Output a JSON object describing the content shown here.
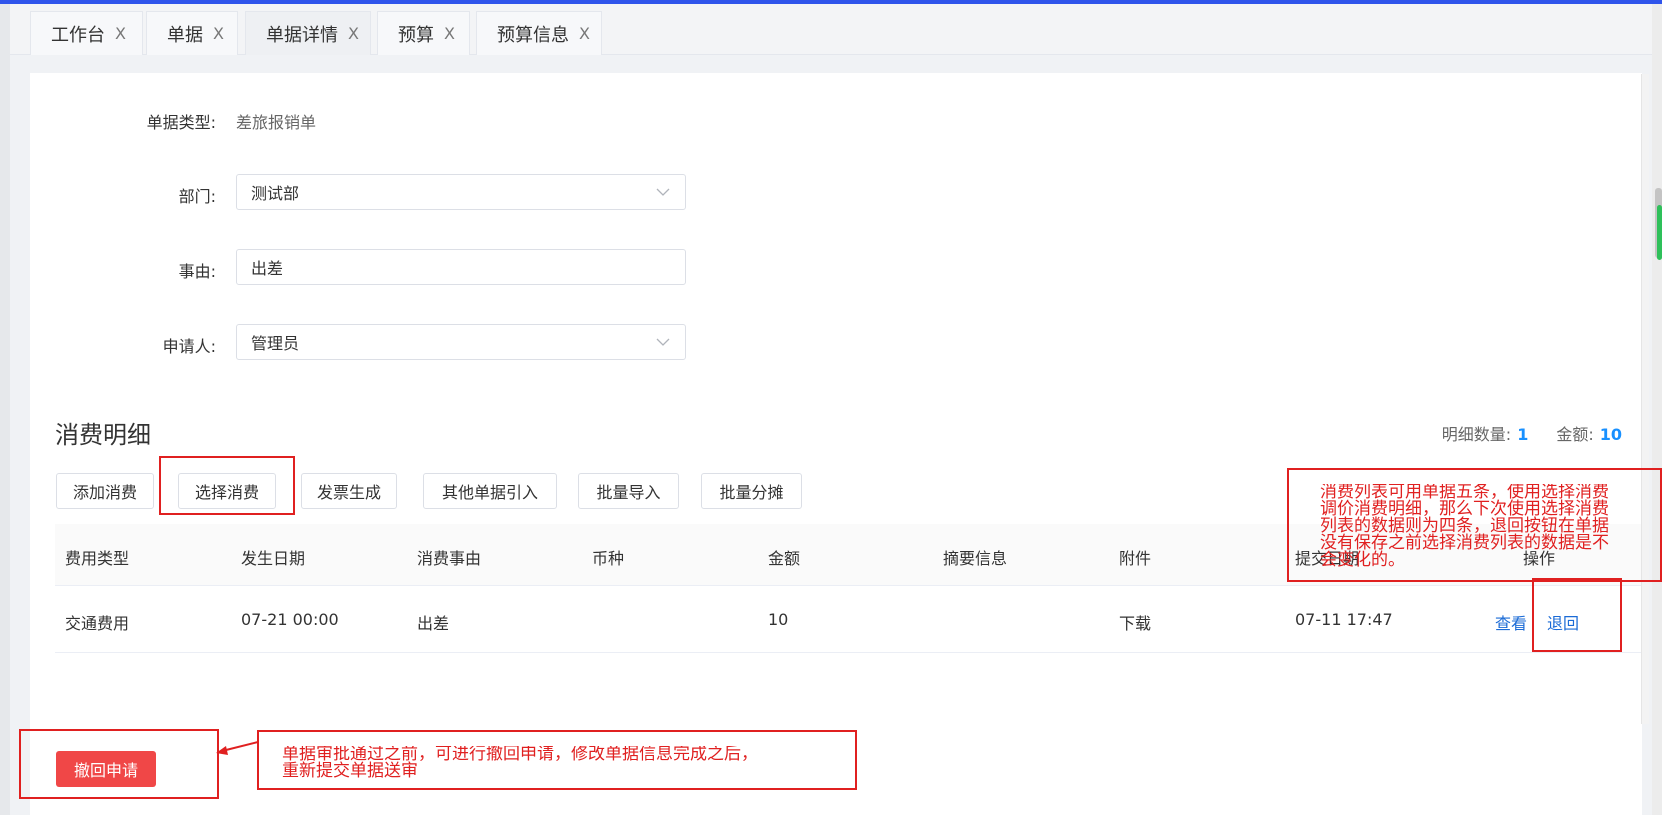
{
  "tabs": [
    {
      "label": "工作台",
      "close": "X"
    },
    {
      "label": "单据",
      "close": "X"
    },
    {
      "label": "单据详情",
      "close": "X"
    },
    {
      "label": "预算",
      "close": "X"
    },
    {
      "label": "预算信息",
      "close": "X"
    }
  ],
  "form": {
    "doc_type_label": "单据类型:",
    "doc_type_value": "差旅报销单",
    "department_label": "部门:",
    "department_value": "测试部",
    "reason_label": "事由:",
    "reason_value": "出差",
    "applicant_label": "申请人:",
    "applicant_value": "管理员"
  },
  "section": {
    "title": "消费明细",
    "count_label": "明细数量:",
    "count_value": "1",
    "amount_label": "金额:",
    "amount_value": "10"
  },
  "buttons": {
    "add": "添加消费",
    "select": "选择消费",
    "invoice": "发票生成",
    "import_other": "其他单据引入",
    "batch_import": "批量导入",
    "batch_split": "批量分摊"
  },
  "table": {
    "headers": [
      "费用类型",
      "发生日期",
      "消费事由",
      "币种",
      "金额",
      "摘要信息",
      "附件",
      "提交日期",
      "操作"
    ],
    "rows": [
      {
        "type": "交通费用",
        "date": "07-21 00:00",
        "reason": "出差",
        "currency": "",
        "amount": "10",
        "summary": "",
        "attachment": "下载",
        "submit_date": "07-11 17:47",
        "view": "查看",
        "return": "退回"
      }
    ]
  },
  "recall_button": "撤回申请",
  "annotations": {
    "right_note_lines": [
      "消费列表可用单据五条，使用选择消费",
      "调价消费明细，那么下次使用选择消费",
      "列表的数据则为四条，退回按钮在单据",
      "没有保存之前选择消费列表的数据是不",
      "会变化的。"
    ],
    "bottom_note_lines": [
      "单据审批通过之前，可进行撤回申请，修改单据信息完成之后，",
      "重新提交单据送审"
    ]
  },
  "colors": {
    "accent": "#1890ff",
    "link": "#1b6bd6",
    "danger": "#f04747",
    "annotation": "#e02020",
    "top_line": "#2f54eb"
  }
}
